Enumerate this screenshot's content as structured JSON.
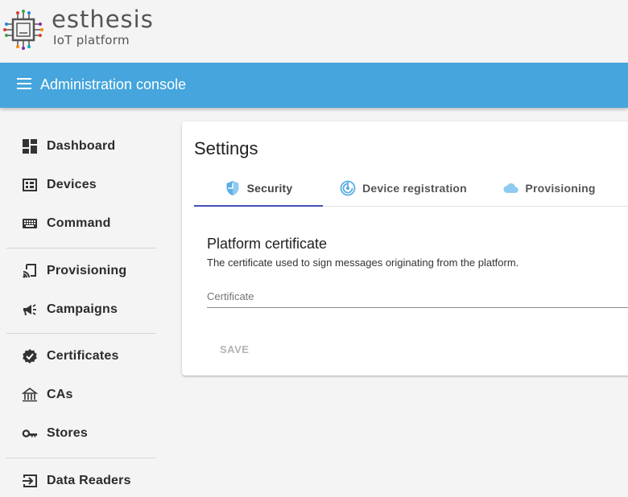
{
  "brand": {
    "title": "esthesis",
    "subtitle": "IoT platform"
  },
  "toolbar": {
    "title": "Administration console"
  },
  "sidebar": {
    "items": [
      {
        "label": "Dashboard",
        "icon": "dashboard-icon"
      },
      {
        "label": "Devices",
        "icon": "devices-icon"
      },
      {
        "label": "Command",
        "icon": "keyboard-icon"
      },
      {
        "label": "Provisioning",
        "icon": "cast-icon"
      },
      {
        "label": "Campaigns",
        "icon": "campaign-icon"
      },
      {
        "label": "Certificates",
        "icon": "verified-badge-icon"
      },
      {
        "label": "CAs",
        "icon": "account-balance-icon"
      },
      {
        "label": "Stores",
        "icon": "key-icon"
      },
      {
        "label": "Data Readers",
        "icon": "input-icon"
      }
    ]
  },
  "settings": {
    "title": "Settings",
    "tabs": [
      {
        "label": "Security",
        "icon": "shield-icon"
      },
      {
        "label": "Device registration",
        "icon": "registration-icon"
      },
      {
        "label": "Provisioning",
        "icon": "cloud-icon"
      }
    ],
    "section_title": "Platform certificate",
    "section_desc": "The certificate used to sign messages originating from the platform.",
    "certificate_placeholder": "Certificate",
    "certificate_value": "",
    "save_label": "SAVE"
  },
  "colors": {
    "toolbar": "#45a5dc",
    "tab_ink": "#3f51b5",
    "tab_icon": "#5aaee2"
  }
}
